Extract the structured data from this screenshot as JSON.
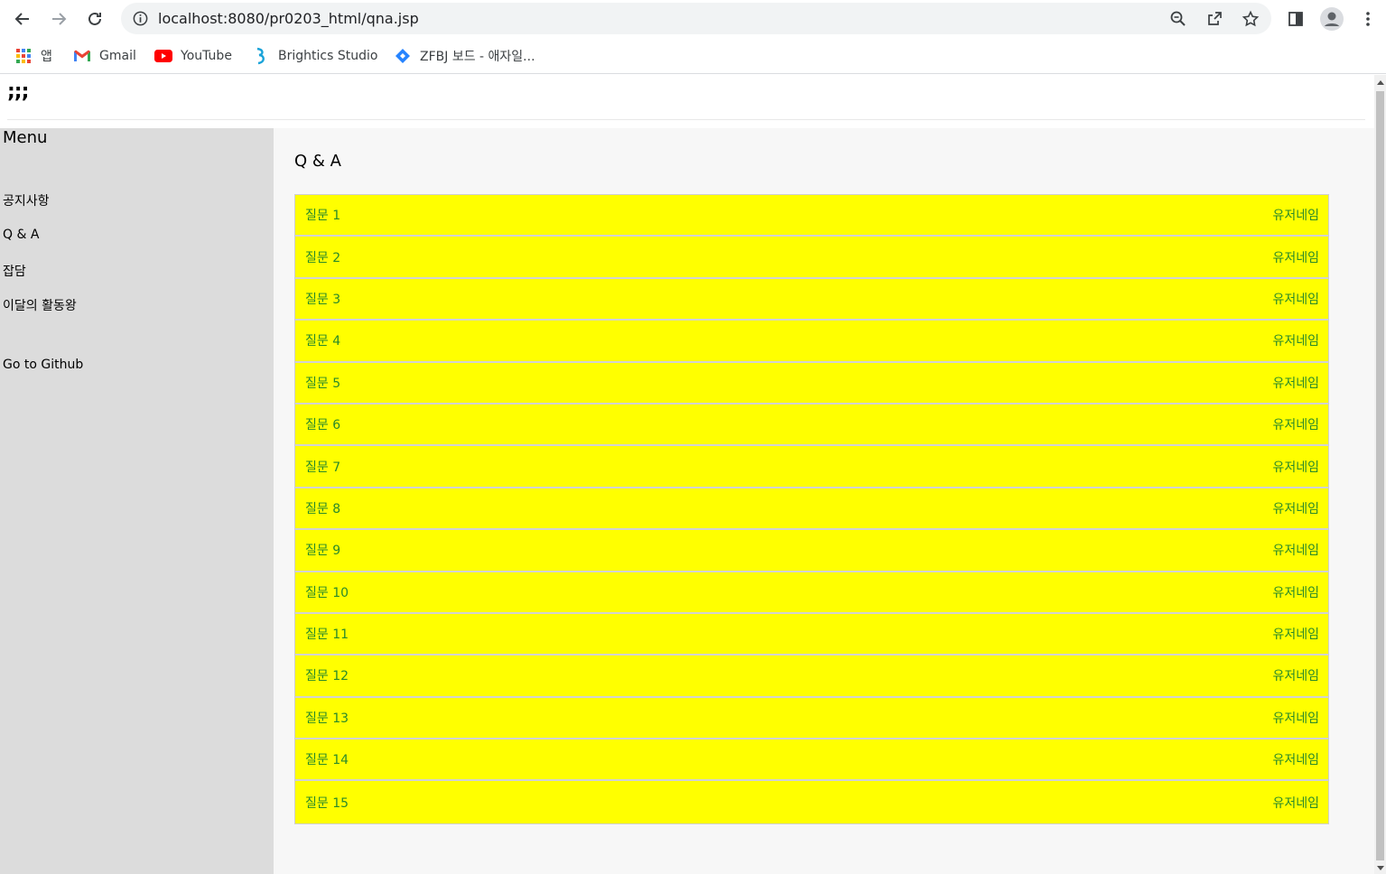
{
  "browser": {
    "url": "localhost:8080/pr0203_html/qna.jsp",
    "bookmarks": [
      {
        "label": "앱",
        "icon": "apps-grid-icon"
      },
      {
        "label": "Gmail",
        "icon": "gmail-icon"
      },
      {
        "label": "YouTube",
        "icon": "youtube-icon"
      },
      {
        "label": "Brightics Studio",
        "icon": "brightics-icon"
      },
      {
        "label": "ZFBJ 보드 - 애자일...",
        "icon": "jira-icon"
      }
    ]
  },
  "header": {
    "logo": ";;;"
  },
  "sidebar": {
    "title": "Menu",
    "items": [
      {
        "label": "공지사항"
      },
      {
        "label": "Q & A"
      },
      {
        "label": "잡담"
      },
      {
        "label": "이달의 활동왕"
      }
    ],
    "github_label": "Go to Github"
  },
  "main": {
    "title": "Q & A",
    "questions": [
      {
        "title": "질문 1",
        "user": "유저네임"
      },
      {
        "title": "질문 2",
        "user": "유저네임"
      },
      {
        "title": "질문 3",
        "user": "유저네임"
      },
      {
        "title": "질문 4",
        "user": "유저네임"
      },
      {
        "title": "질문 5",
        "user": "유저네임"
      },
      {
        "title": "질문 6",
        "user": "유저네임"
      },
      {
        "title": "질문 7",
        "user": "유저네임"
      },
      {
        "title": "질문 8",
        "user": "유저네임"
      },
      {
        "title": "질문 9",
        "user": "유저네임"
      },
      {
        "title": "질문 10",
        "user": "유저네임"
      },
      {
        "title": "질문 11",
        "user": "유저네임"
      },
      {
        "title": "질문 12",
        "user": "유저네임"
      },
      {
        "title": "질문 13",
        "user": "유저네임"
      },
      {
        "title": "질문 14",
        "user": "유저네임"
      },
      {
        "title": "질문 15",
        "user": "유저네임"
      }
    ]
  },
  "colors": {
    "row_bg": "#ffff00",
    "row_text": "#2a8a2a",
    "sidebar_bg": "#dcdcdc",
    "main_bg": "#f7f7f7"
  }
}
